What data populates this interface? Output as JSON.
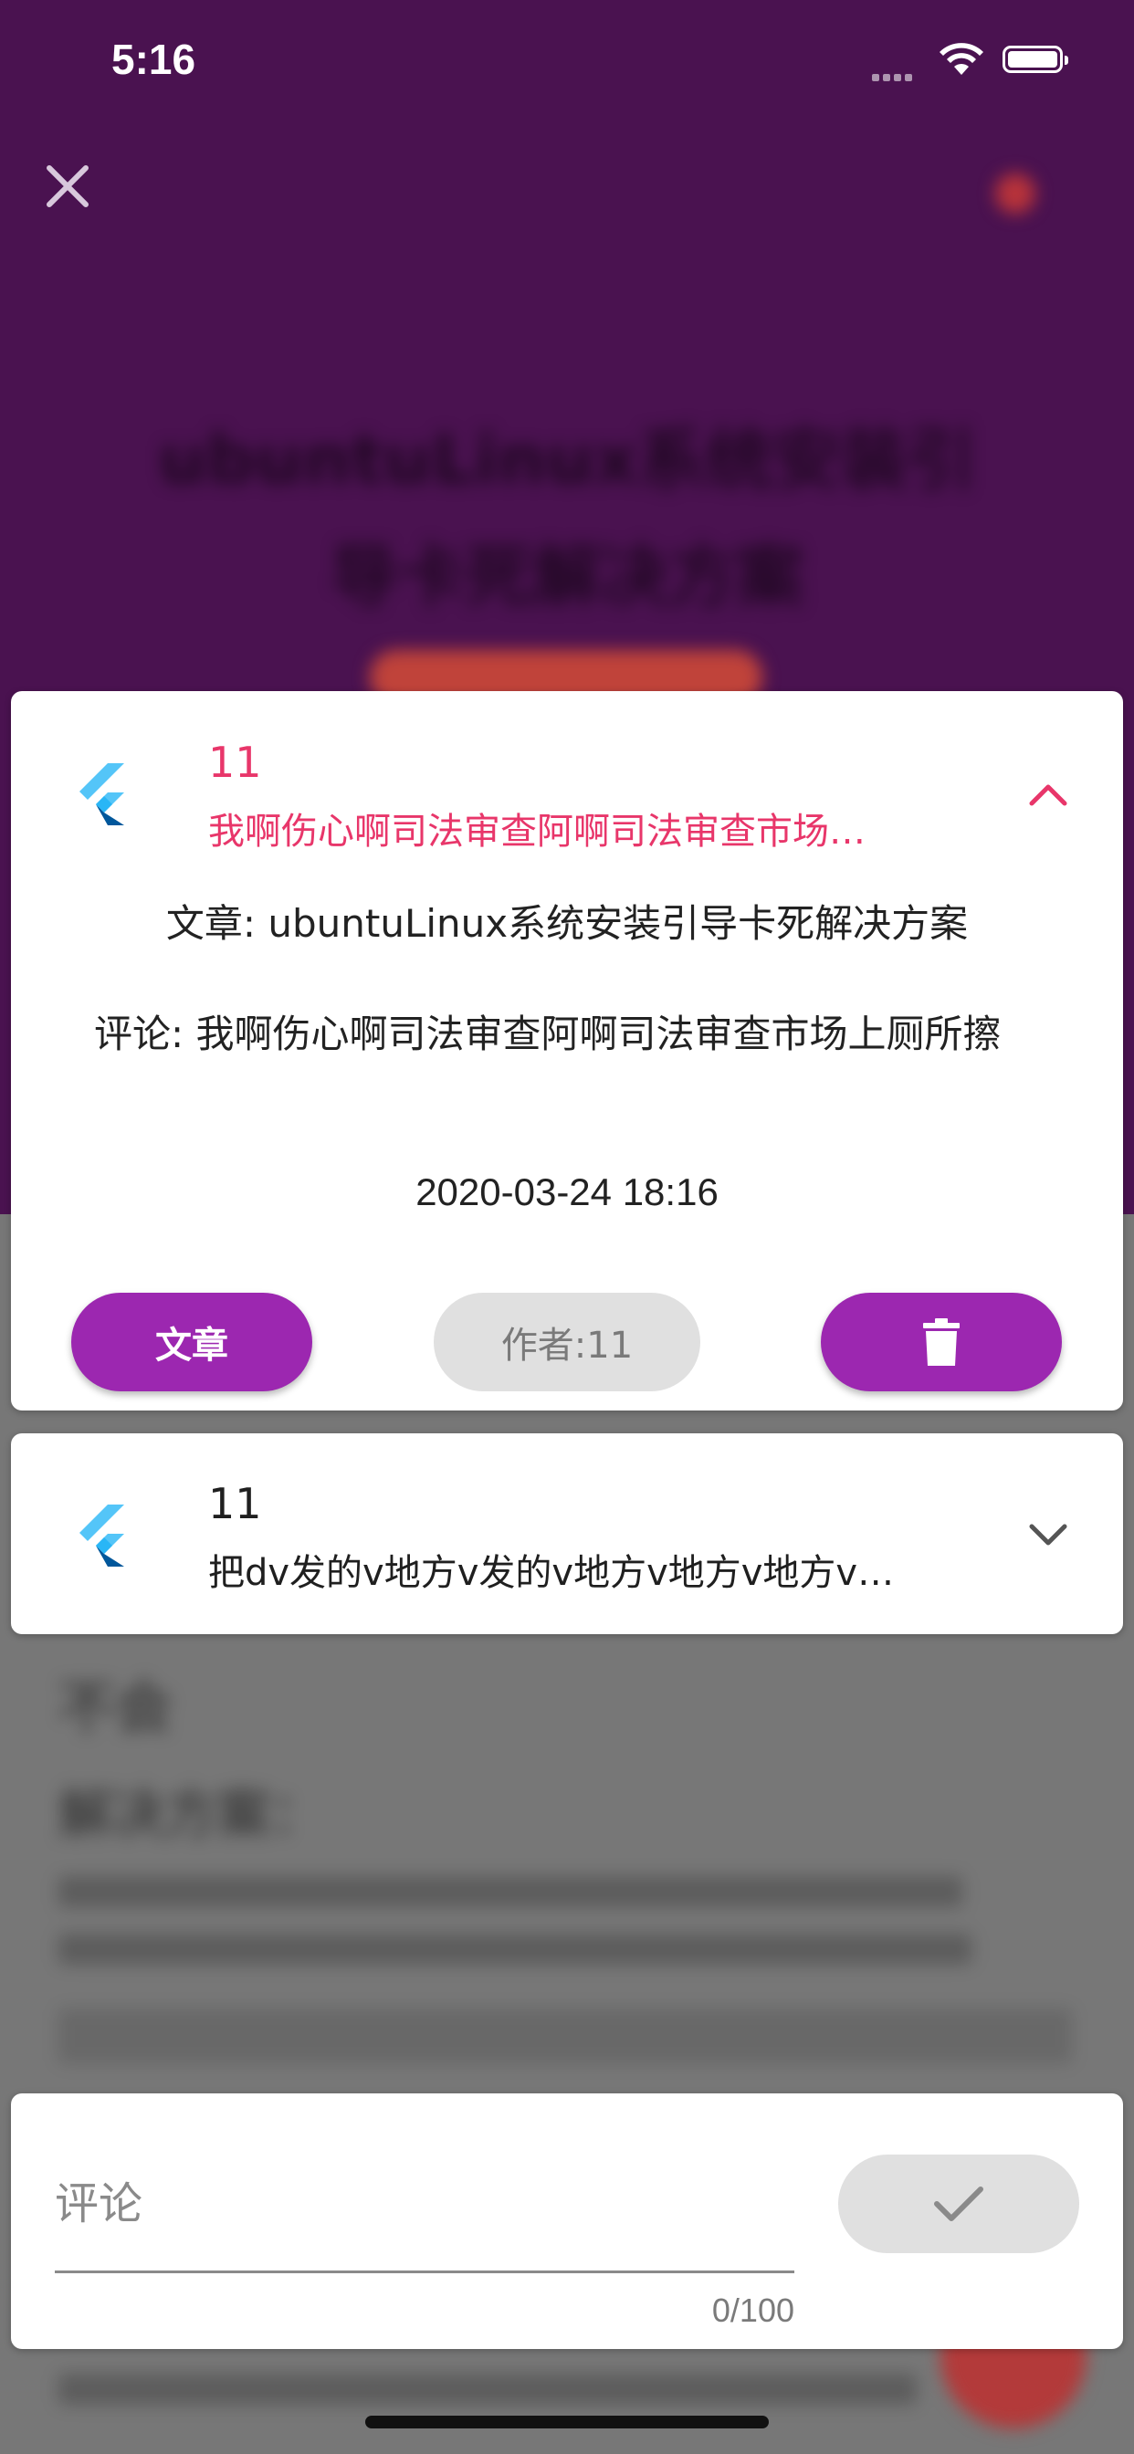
{
  "status_bar": {
    "time": "5:16"
  },
  "background": {
    "title_line1": "ubuntuLinux系统安装引",
    "title_line2": "导卡死解决方案",
    "section_heading_1": "不会",
    "section_heading_2": "解决方案："
  },
  "comments": [
    {
      "author": "11",
      "preview": "我啊伤心啊司法审查阿啊司法审查市场…",
      "expanded": true,
      "article_label": "文章: ubuntuLinux系统安装引导卡死解决方案",
      "comment_label": "评论: 我啊伤心啊司法审查阿啊司法审查市场上厕所擦",
      "date": "2020-03-24 18:16",
      "buttons": {
        "article": "文章",
        "author": "作者:11"
      }
    },
    {
      "author": "11",
      "preview": "把dv发的v地方v发的v地方v地方v地方v…",
      "expanded": false
    }
  ],
  "comment_input": {
    "placeholder": "评论",
    "value": "",
    "counter": "0/100"
  },
  "colors": {
    "accent": "#9c27b0",
    "pink": "#e8366a",
    "header_bg": "#4a1250"
  },
  "icons": [
    "close-icon",
    "flutter-logo-icon",
    "chevron-up-icon",
    "chevron-down-icon",
    "trash-icon",
    "check-icon",
    "wifi-icon",
    "battery-icon"
  ]
}
